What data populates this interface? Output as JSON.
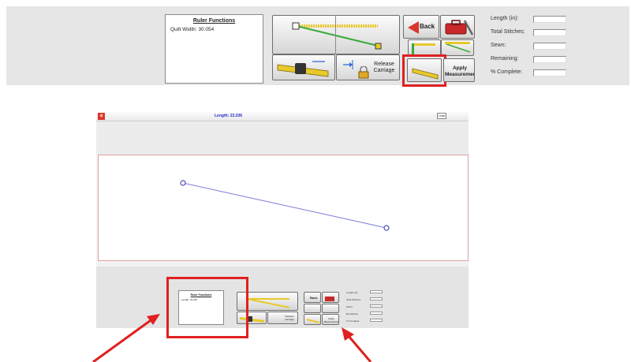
{
  "toolbar": {
    "ruler_title": "Ruler Functions",
    "quilt_width": "Quilt Width: 30.054",
    "back_label": "Back",
    "release_carriage_label": "Release Carriage",
    "apply_measurement_label": "Apply Measurement",
    "stats": [
      {
        "label": "Length (in):",
        "value": ""
      },
      {
        "label": "Total Stitches:",
        "value": ""
      },
      {
        "label": "Sewn:",
        "value": ""
      },
      {
        "label": "Remaining:",
        "value": ""
      },
      {
        "label": "% Complete:",
        "value": ""
      }
    ]
  },
  "window": {
    "length_text": "Length: 23.206",
    "small_button": "Close",
    "mini_ruler_title": "Ruler Functions",
    "mini_length": "Length: 23.206",
    "mini_back": "Back",
    "mini_release": "Release Carriage",
    "mini_apply": "Apply Measurement",
    "mini_stats": [
      "Length (in):",
      "Total Stitches:",
      "Sewn:",
      "Remaining:",
      "% Complete:"
    ]
  },
  "colors": {
    "highlight": "#e02020",
    "ruler_line": "#7b7bd8",
    "ruler_yellow": "#e8c82a",
    "ruler_green": "#3aaa3a"
  },
  "icons": [
    "ruler-line-icon",
    "ruler-tape-icon",
    "back-arrow-icon",
    "toolbox-icon",
    "lock-icon",
    "release-arrow-icon",
    "ruler-diagonal-icon",
    "close-icon"
  ]
}
